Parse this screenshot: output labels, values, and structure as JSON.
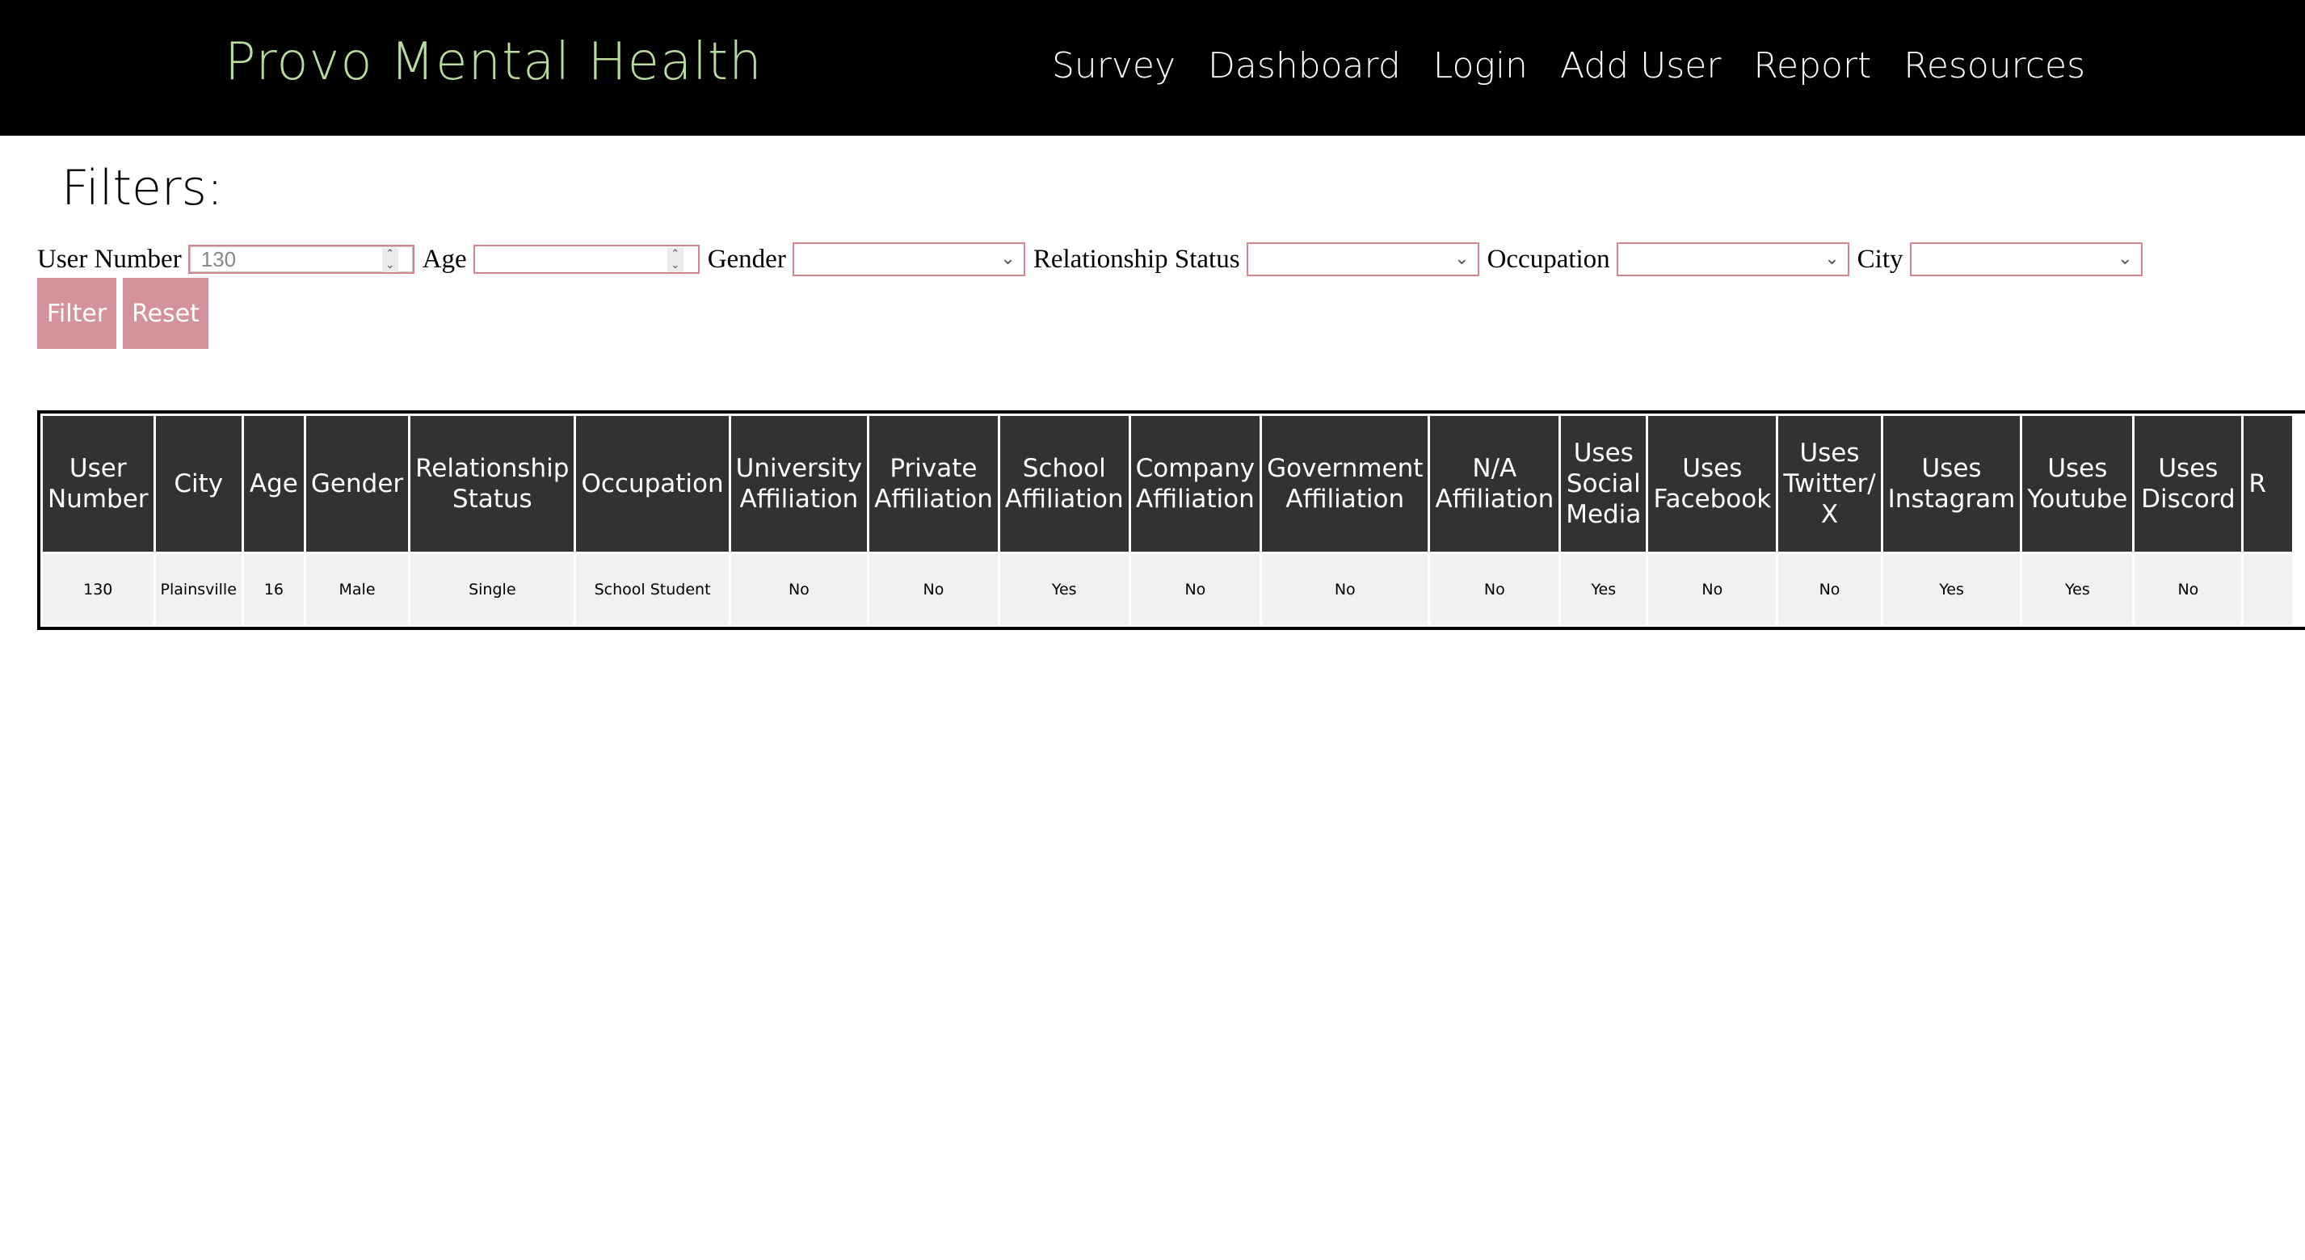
{
  "app": {
    "brand": "Provo Mental Health"
  },
  "nav": [
    "Survey",
    "Dashboard",
    "Login",
    "Add User",
    "Report",
    "Resources"
  ],
  "filters": {
    "title": "Filters:",
    "user_number_label": "User Number",
    "user_number_value": "130",
    "age_label": "Age",
    "age_value": "",
    "gender_label": "Gender",
    "gender_value": "",
    "relationship_label": "Relationship Status",
    "relationship_value": "",
    "occupation_label": "Occupation",
    "occupation_value": "",
    "city_label": "City",
    "city_value": "",
    "filter_button": "Filter",
    "reset_button": "Reset"
  },
  "table": {
    "headers": [
      [
        "User",
        "Number"
      ],
      [
        "City"
      ],
      [
        "Age"
      ],
      [
        "Gender"
      ],
      [
        "Relationship",
        "Status"
      ],
      [
        "Occupation"
      ],
      [
        "University",
        "Affiliation"
      ],
      [
        "Private",
        "Affiliation"
      ],
      [
        "School",
        "Affiliation"
      ],
      [
        "Company",
        "Affiliation"
      ],
      [
        "Government",
        "Affiliation"
      ],
      [
        "N/A",
        "Affiliation"
      ],
      [
        "Uses",
        "Social",
        "Media"
      ],
      [
        "Uses",
        "Facebook"
      ],
      [
        "Uses",
        "Twitter/",
        "X"
      ],
      [
        "Uses",
        "Instagram"
      ],
      [
        "Uses",
        "Youtube"
      ],
      [
        "Uses",
        "Discord"
      ],
      [
        "R"
      ]
    ],
    "rows": [
      [
        "130",
        "Plainsville",
        "16",
        "Male",
        "Single",
        "School Student",
        "No",
        "No",
        "Yes",
        "No",
        "No",
        "No",
        "Yes",
        "No",
        "No",
        "Yes",
        "Yes",
        "No",
        ""
      ]
    ]
  },
  "colors": {
    "navbar": "#000000",
    "brand": "#b9dba0",
    "accent": "#d4939a",
    "header_cell": "#323232"
  }
}
